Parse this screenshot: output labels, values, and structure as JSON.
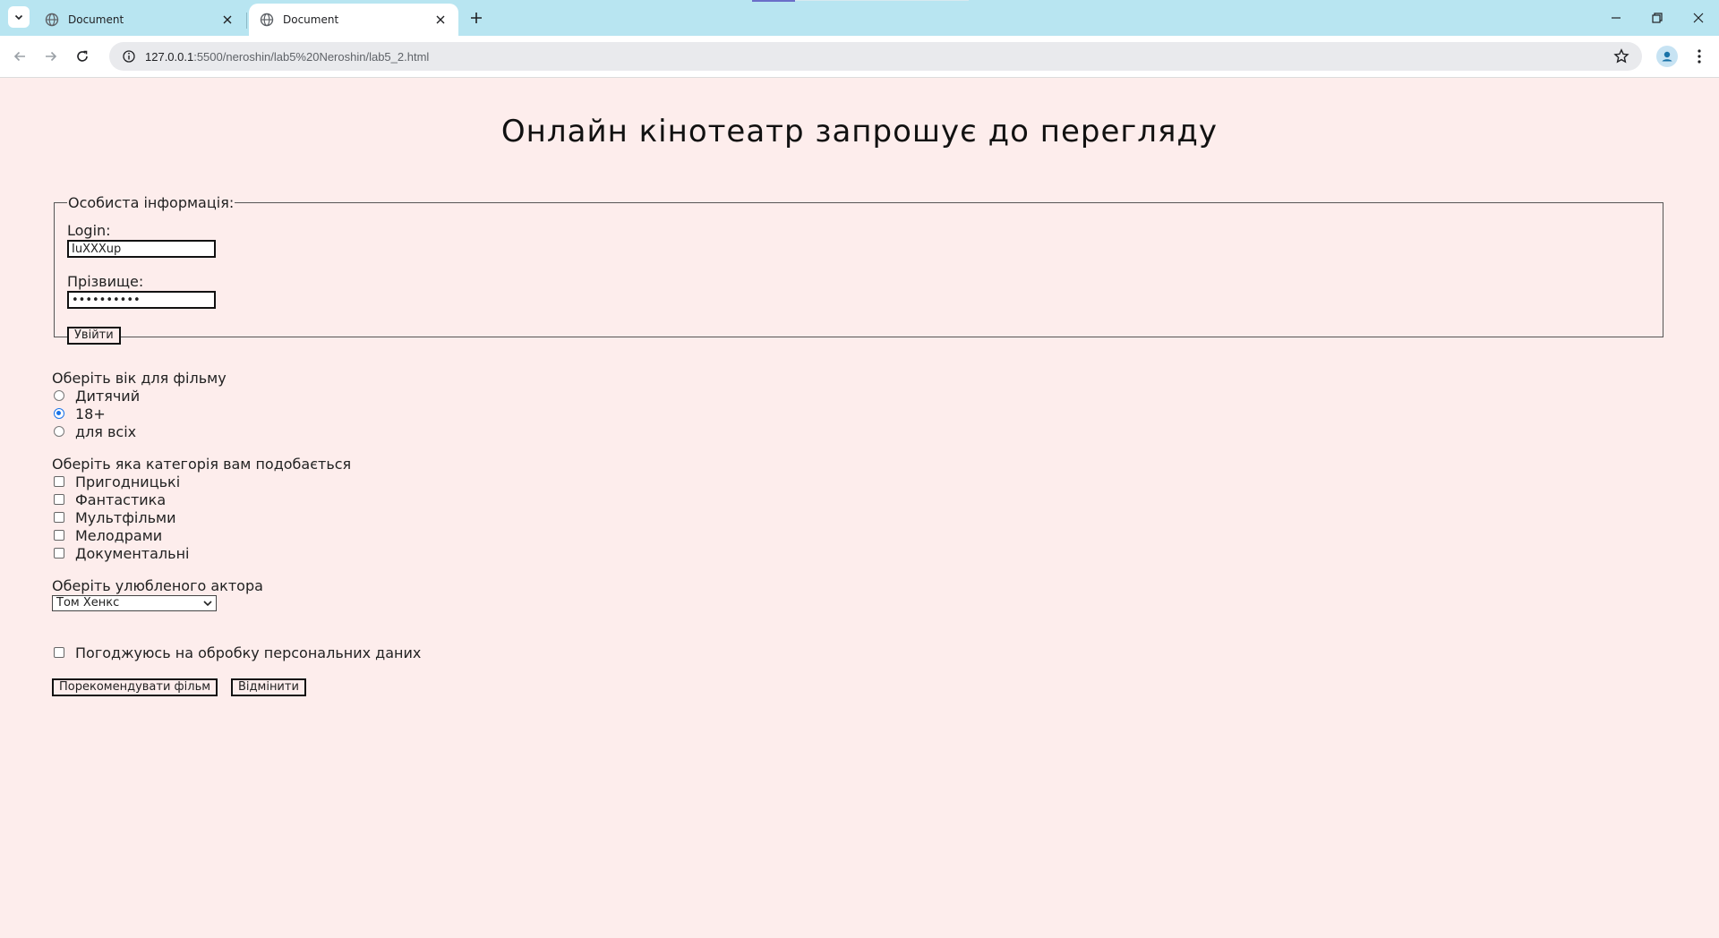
{
  "browser": {
    "tabs": [
      {
        "title": "Document",
        "active": false
      },
      {
        "title": "Document",
        "active": true
      }
    ],
    "url_host": "127.0.0.1",
    "url_path": ":5500/neroshin/lab5%20Neroshin/lab5_2.html",
    "accent_color": "#b8e5f1"
  },
  "page": {
    "heading": "Онлайн кінотеатр запрошує до перегляду",
    "background": "#fdedec",
    "personal": {
      "legend": "Особиста інформація:",
      "login_label": "Login:",
      "login_value": "IuXXXup",
      "surname_label": "Прізвище:",
      "surname_value": "••••••••••",
      "submit_label": "Увійти"
    },
    "age": {
      "title": "Оберіть вік для фільму",
      "options": [
        {
          "label": "Дитячий",
          "checked": false
        },
        {
          "label": "18+",
          "checked": true
        },
        {
          "label": "для всіх",
          "checked": false
        }
      ]
    },
    "category": {
      "title": "Оберіть яка категорія вам подобається",
      "options": [
        {
          "label": "Пригодницькі",
          "checked": false
        },
        {
          "label": "Фантастика",
          "checked": false
        },
        {
          "label": "Мультфільми",
          "checked": false
        },
        {
          "label": "Мелодрами",
          "checked": false
        },
        {
          "label": "Документальні",
          "checked": false
        }
      ]
    },
    "actor": {
      "title": "Оберіть улюбленого актора",
      "selected": "Том Хенкс"
    },
    "consent_label": "Погоджуюсь на обробку персональних даних",
    "recommend_button": "Порекомендувати фільм",
    "cancel_button": "Відмінити"
  }
}
